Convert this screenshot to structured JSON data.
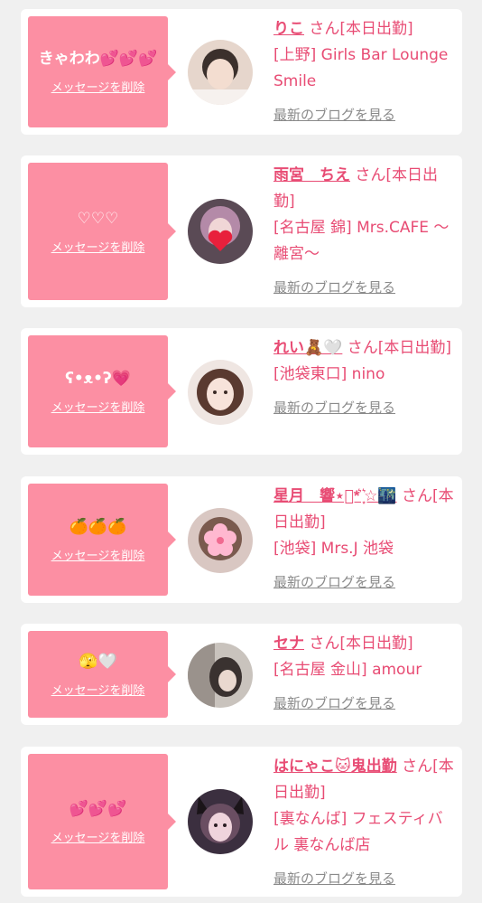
{
  "ui": {
    "delete_label": "メッセージを削除",
    "blog_label": "最新のブログを見る"
  },
  "cards": [
    {
      "message": "きゃわわ💕💕💕",
      "name": "りこ",
      "suffix": " さん[本日出勤]",
      "shop": "[上野] Girls Bar Lounge Smile"
    },
    {
      "message": "♡♡♡",
      "name": "雨宮　ちえ",
      "suffix": " さん[本日出勤]",
      "shop": "[名古屋 錦] Mrs.CAFE ～離宮～"
    },
    {
      "message": "ʕ•ᴥ•ʔ💗",
      "name": "れい🧸🤍",
      "suffix": " さん[本日出勤]",
      "shop": "[池袋東口] nino"
    },
    {
      "message": "🍊🍊🍊",
      "name": "星月　響⋆͛*͛ ͙͛☆🌃",
      "suffix": " さん[本日出勤]",
      "shop": "[池袋] Mrs.J 池袋"
    },
    {
      "message": "🫣🤍",
      "name": "セナ",
      "suffix": " さん[本日出勤]",
      "shop": "[名古屋 金山] amour"
    },
    {
      "message": "💕💕💕",
      "name": "はにゃこ🐱鬼出勤",
      "suffix": " さん[本日出勤]",
      "shop": "[裏なんば] フェスティバル 裏なんば店"
    }
  ]
}
